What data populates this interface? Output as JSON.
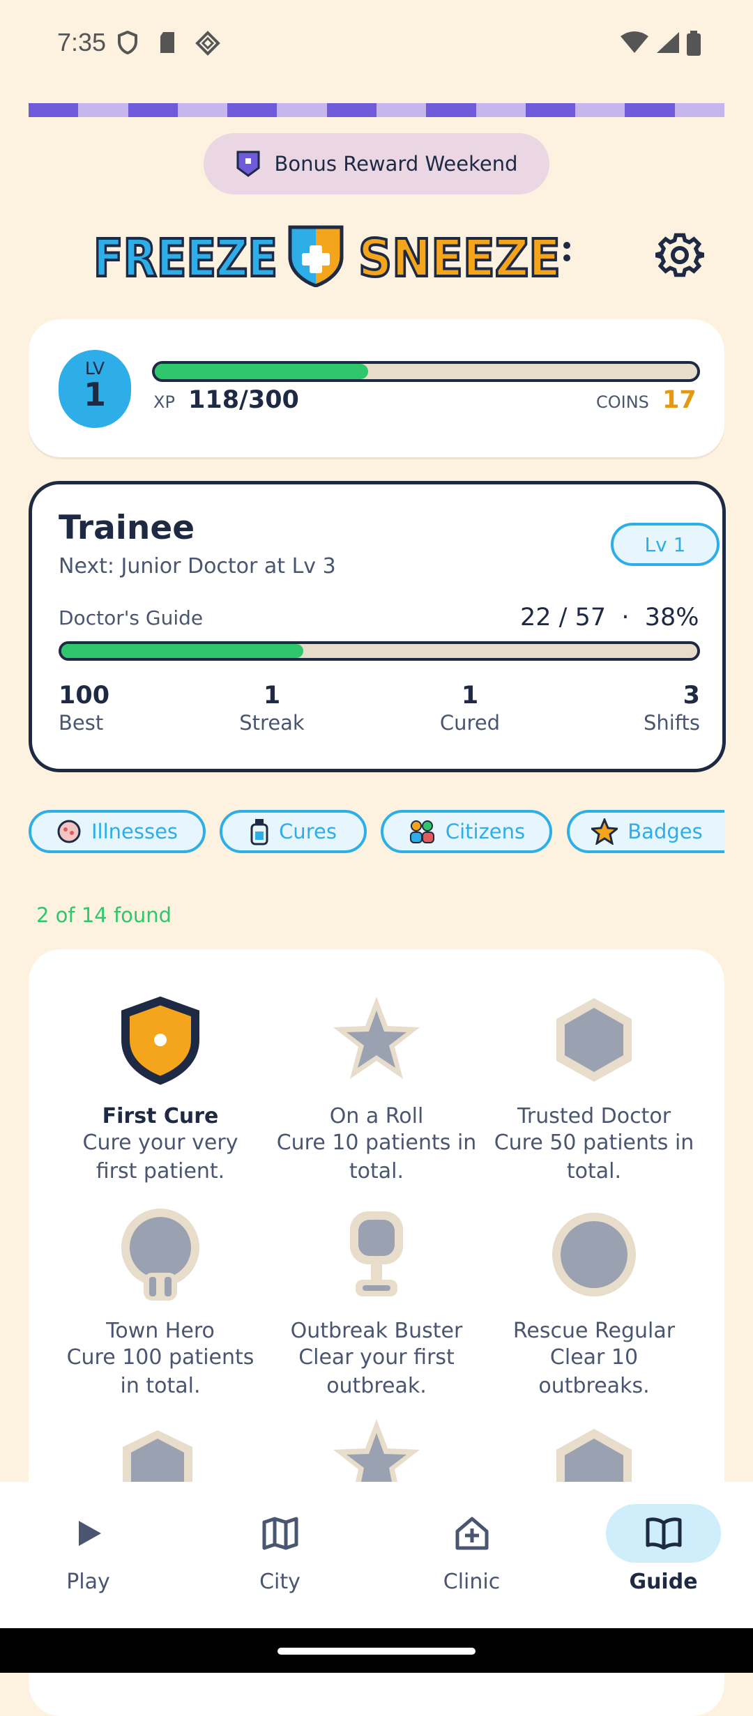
{
  "status": {
    "time": "7:35"
  },
  "bonus": {
    "label": "Bonus Reward Weekend"
  },
  "logo": {
    "word1": "FREEZE",
    "word2": "SNEEZE"
  },
  "player": {
    "level_label": "LV",
    "level": "1",
    "xp_label": "XP",
    "xp": "118/300",
    "xp_progress": 0.393,
    "coins_label": "COINS",
    "coins": "17"
  },
  "rank": {
    "title": "Trainee",
    "next": "Next: Junior Doctor at Lv 3",
    "level_pill": "Lv 1",
    "guide_label": "Doctor's Guide",
    "guide_value": "22 / 57  ·  38%",
    "guide_progress": 0.38,
    "stats": [
      {
        "value": "100",
        "label": "Best"
      },
      {
        "value": "1",
        "label": "Streak"
      },
      {
        "value": "1",
        "label": "Cured"
      },
      {
        "value": "3",
        "label": "Shifts"
      }
    ]
  },
  "tabs": [
    {
      "label": "Illnesses",
      "icon": "germ-icon"
    },
    {
      "label": "Cures",
      "icon": "bottle-icon"
    },
    {
      "label": "Citizens",
      "icon": "people-icon"
    },
    {
      "label": "Badges",
      "icon": "star-icon"
    }
  ],
  "found": "2 of 14 found",
  "badges": [
    {
      "title": "First Cure",
      "desc1": "Cure your very",
      "desc2": "first patient.",
      "unlocked": true,
      "icon": "shield-icon"
    },
    {
      "title": "On a Roll",
      "desc1": "Cure 10 patients in",
      "desc2": "total.",
      "unlocked": false,
      "icon": "star-icon"
    },
    {
      "title": "Trusted Doctor",
      "desc1": "Cure 50 patients in",
      "desc2": "total.",
      "unlocked": false,
      "icon": "hexagon-icon"
    },
    {
      "title": "Town Hero",
      "desc1": "Cure 100 patients",
      "desc2": "in total.",
      "unlocked": false,
      "icon": "medal-icon"
    },
    {
      "title": "Outbreak Buster",
      "desc1": "Clear your first",
      "desc2": "outbreak.",
      "unlocked": false,
      "icon": "trophy-icon"
    },
    {
      "title": "Rescue Regular",
      "desc1": "Clear 10",
      "desc2": "outbreaks.",
      "unlocked": false,
      "icon": "circle-icon"
    }
  ],
  "nav": [
    {
      "label": "Play",
      "icon": "play-icon"
    },
    {
      "label": "City",
      "icon": "map-icon"
    },
    {
      "label": "Clinic",
      "icon": "clinic-icon"
    },
    {
      "label": "Guide",
      "icon": "book-icon",
      "selected": true
    }
  ],
  "colors": {
    "accent": "#2eaee8",
    "green": "#2fc76b",
    "gold": "#e39a12",
    "navy": "#1e2a44",
    "background": "#fdf2e0"
  }
}
